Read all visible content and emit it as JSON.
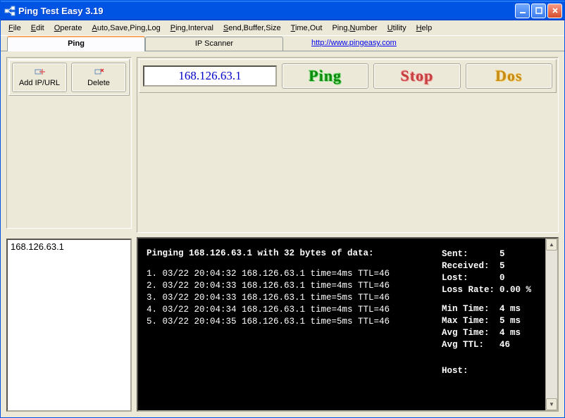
{
  "window": {
    "title": "Ping Test Easy 3.19"
  },
  "menu": {
    "file": "File",
    "edit": "Edit",
    "operate": "Operate",
    "autosave": "Auto,Save,Ping,Log",
    "interval": "Ping,Interval",
    "buffer": "Send,Buffer,Size",
    "timeout": "Time,Out",
    "number": "Ping,Number",
    "utility": "Utility",
    "help": "Help"
  },
  "tabs": {
    "ping": "Ping",
    "scanner": "IP Scanner",
    "link": "http://www.pingeasy.com"
  },
  "sidebar": {
    "add": "Add IP/URL",
    "delete": "Delete",
    "listitem": "168.126.63.1"
  },
  "top": {
    "ip": "168.126.63.1",
    "ping": "Ping",
    "stop": "Stop",
    "dos": "Dos"
  },
  "console": {
    "header": "Pinging  168.126.63.1  with 32 bytes of data:",
    "rows": [
      {
        "n": "1.",
        "dt": "03/22 20:04:32",
        "ip": "168.126.63.1",
        "time": "time=4ms",
        "ttl": "TTL=46"
      },
      {
        "n": "2.",
        "dt": "03/22 20:04:33",
        "ip": "168.126.63.1",
        "time": "time=4ms",
        "ttl": "TTL=46"
      },
      {
        "n": "3.",
        "dt": "03/22 20:04:33",
        "ip": "168.126.63.1",
        "time": "time=5ms",
        "ttl": "TTL=46"
      },
      {
        "n": "4.",
        "dt": "03/22 20:04:34",
        "ip": "168.126.63.1",
        "time": "time=4ms",
        "ttl": "TTL=46"
      },
      {
        "n": "5.",
        "dt": "03/22 20:04:35",
        "ip": "168.126.63.1",
        "time": "time=5ms",
        "ttl": "TTL=46"
      }
    ],
    "stats": {
      "sent_k": "Sent:",
      "sent_v": "5",
      "recv_k": "Received:",
      "recv_v": "5",
      "lost_k": "Lost:",
      "lost_v": "0",
      "loss_k": "Loss Rate:",
      "loss_v": "0.00 %",
      "min_k": "Min Time:",
      "min_v": "4 ms",
      "max_k": "Max Time:",
      "max_v": "5 ms",
      "avg_k": "Avg Time:",
      "avg_v": "4 ms",
      "ttl_k": "Avg TTL:",
      "ttl_v": "46",
      "host_k": "Host:",
      "host_v": ""
    }
  }
}
